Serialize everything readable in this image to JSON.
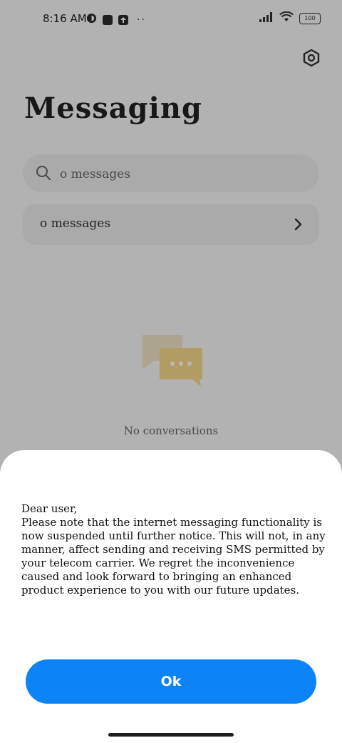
{
  "status_bar": {
    "time": "8:16 AM",
    "battery": "100",
    "icons_left": [
      "vpn-icon",
      "square-icon",
      "upload-icon",
      "more-dots-icon"
    ],
    "icons_right": [
      "signal-icon",
      "wifi-icon",
      "battery-icon"
    ]
  },
  "header": {
    "title": "Messaging",
    "settings_icon": "settings-hex-icon"
  },
  "search": {
    "placeholder": "o messages"
  },
  "conversation_row": {
    "label": "o messages"
  },
  "empty_state": {
    "text": "No conversations",
    "icon": "chat-bubbles-icon"
  },
  "dialog": {
    "greeting": "Dear user,",
    "body": "Please note that the internet messaging functionality is now suspended until further notice. This will not, in any manner, affect sending and receiving SMS permitted by your telecom carrier. We regret the inconvenience caused and look forward to bringing an enhanced product experience to you with our future updates.",
    "ok_label": "Ok"
  },
  "colors": {
    "accent": "#0c84f7",
    "background": "#f7f7f7",
    "overlay": "rgba(0,0,0,0.28)",
    "sheet": "#ffffff"
  }
}
